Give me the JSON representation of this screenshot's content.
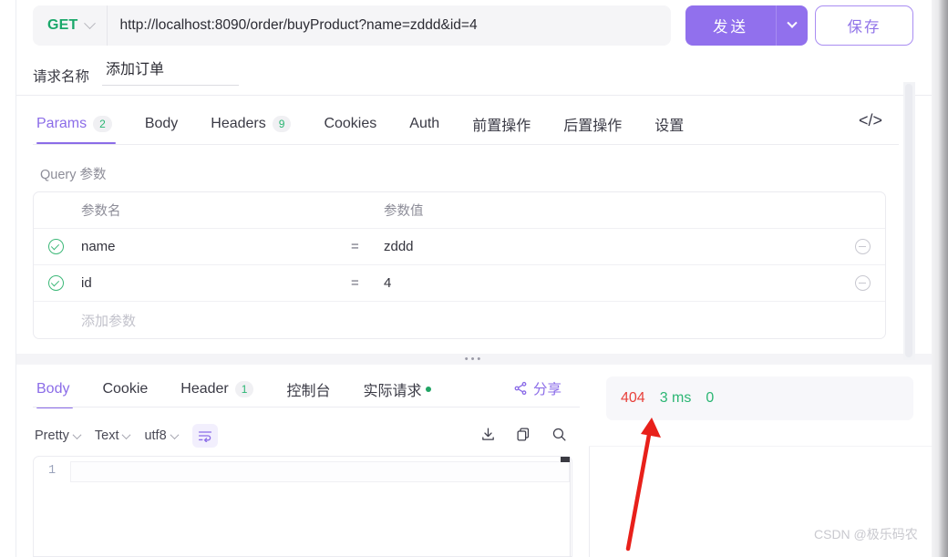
{
  "request_bar": {
    "method": "GET",
    "method_caret": "chevron-down",
    "url": "http://localhost:8090/order/buyProduct?name=zddd&id=4",
    "send_label": "发送",
    "send_caret": "chevron-down",
    "save_label": "保存"
  },
  "request_name": {
    "label": "请求名称",
    "value": "添加订单"
  },
  "request_tabs": {
    "items": [
      {
        "label": "Params",
        "badge": "2",
        "active": true
      },
      {
        "label": "Body",
        "badge": "",
        "active": false
      },
      {
        "label": "Headers",
        "badge": "9",
        "active": false
      },
      {
        "label": "Cookies",
        "badge": "",
        "active": false
      },
      {
        "label": "Auth",
        "badge": "",
        "active": false
      },
      {
        "label": "前置操作",
        "badge": "",
        "active": false
      },
      {
        "label": "后置操作",
        "badge": "",
        "active": false
      },
      {
        "label": "设置",
        "badge": "",
        "active": false
      }
    ],
    "code_icon": "</>"
  },
  "params": {
    "section_title": "Query 参数",
    "headers": {
      "name": "参数名",
      "value": "参数值"
    },
    "rows": [
      {
        "enabled": true,
        "name": "name",
        "eq": "=",
        "value": "zddd"
      },
      {
        "enabled": true,
        "name": "id",
        "eq": "=",
        "value": "4"
      }
    ],
    "add_placeholder": "添加参数"
  },
  "response_tabs": {
    "items": [
      {
        "label": "Body",
        "badge": "",
        "dot": false,
        "active": true
      },
      {
        "label": "Cookie",
        "badge": "",
        "dot": false,
        "active": false
      },
      {
        "label": "Header",
        "badge": "1",
        "dot": false,
        "active": false
      },
      {
        "label": "控制台",
        "badge": "",
        "dot": false,
        "active": false
      },
      {
        "label": "实际请求",
        "badge": "",
        "dot": true,
        "active": false
      }
    ],
    "share_label": "分享"
  },
  "body_toolbar": {
    "format": "Pretty",
    "type": "Text",
    "charset": "utf8",
    "wrap_icon": "wrap-text-icon",
    "icons": [
      "download-icon",
      "copy-icon",
      "search-icon"
    ]
  },
  "editor": {
    "line_numbers": [
      "1"
    ],
    "content": ""
  },
  "status": {
    "code": "404",
    "time": "3 ms",
    "size": "0"
  },
  "annotation": {
    "arrow_color": "#e8201a"
  },
  "watermark": "CSDN @极乐码农",
  "colors": {
    "accent_purple": "#8b6ce8",
    "method_green": "#1aa86a",
    "error_red": "#e8413b",
    "ok_green": "#2bb673"
  }
}
